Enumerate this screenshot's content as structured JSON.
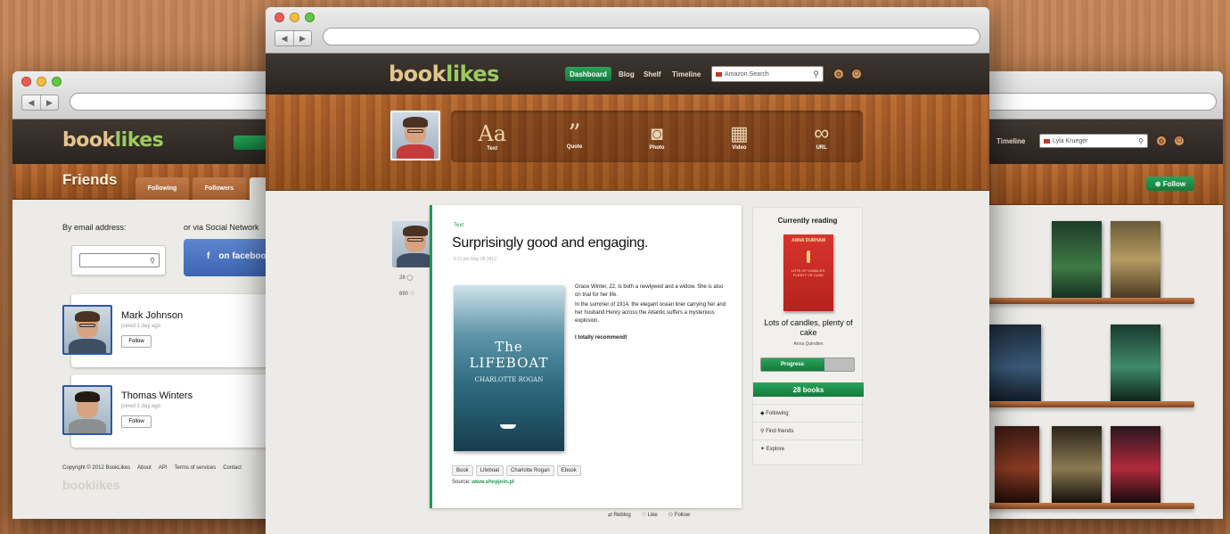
{
  "left_window": {
    "logo": {
      "part1": "book",
      "part2": "likes"
    },
    "page_title": "Friends",
    "tabs": [
      "Following",
      "Followers"
    ],
    "email_label": "By email address:",
    "email_input_value": "",
    "social_label": "or via Social Network",
    "facebook_button": "on facebook",
    "friends": [
      {
        "name": "Mark Johnson",
        "meta": "joined 1 day ago",
        "button": "Follow"
      },
      {
        "name": "Thomas Winters",
        "meta": "joined 1 day ago",
        "button": "Follow"
      }
    ],
    "footer_links": [
      "Copyright © 2012 BookLikes",
      "About",
      "API",
      "Terms of services",
      "Contact"
    ],
    "footer_logo": "booklikes"
  },
  "main_window": {
    "logo": {
      "part1": "book",
      "part2": "likes"
    },
    "nav": {
      "dashboard": "Dashboard",
      "blog": "Blog",
      "shelf": "Shelf",
      "timeline": "Timeline"
    },
    "search": {
      "placeholder": "Amazon Search",
      "icon": "search-icon"
    },
    "post_types": [
      {
        "label": "Text",
        "glyph": "Aa",
        "icon": "text-icon"
      },
      {
        "label": "Quote",
        "glyph": "”",
        "icon": "quote-icon"
      },
      {
        "label": "Photo",
        "glyph": "◙",
        "icon": "photo-icon"
      },
      {
        "label": "Video",
        "glyph": "▦",
        "icon": "video-icon"
      },
      {
        "label": "URL",
        "glyph": "∞",
        "icon": "link-icon"
      }
    ],
    "post": {
      "type_label": "Text",
      "title": "Surprisingly good and engaging.",
      "date": "6:11 pm May 08 2012",
      "book_cover": {
        "title": "The LIFEBOAT",
        "author": "CHARLOTTE ROGAN"
      },
      "body": [
        "Grace Winter, 22, is both a newlywed and a widow. She is also on trial for her life.",
        "In the summer of 1914, the elegant ocean liner carrying her and her husband Henry across the Atlantic suffers a mysterious explosion.",
        "I totally recommend!"
      ],
      "tags": [
        "Book",
        "Lifeboat",
        "Charlotte Rogan",
        "Ebook"
      ],
      "source_label": "Source:",
      "source_value": "www.shopjoin.pl",
      "side_counts": {
        "comments": "28",
        "likes": "890"
      },
      "actions": [
        {
          "label": "Reblog",
          "icon": "reblog-icon"
        },
        {
          "label": "Like",
          "icon": "heart-icon"
        },
        {
          "label": "Follow",
          "icon": "user-icon"
        }
      ]
    },
    "sidebar": {
      "heading": "Currently reading",
      "cover": {
        "author": "ANNA DURHAM",
        "title": "LOTS OF CANDLES, PLENTY OF CAKE"
      },
      "book_title": "Lots of candles, plenty of cake",
      "book_author": "Anna Quindlen",
      "progress": {
        "label": "Progress",
        "fraction": 0.68
      },
      "books_button": "28 books",
      "links": [
        "Following",
        "Find friends",
        "Explore"
      ]
    }
  },
  "right_window": {
    "nav": {
      "timeline": "Timeline"
    },
    "search": {
      "placeholder": "Lyla Krueger"
    },
    "follow_button": "Follow"
  }
}
